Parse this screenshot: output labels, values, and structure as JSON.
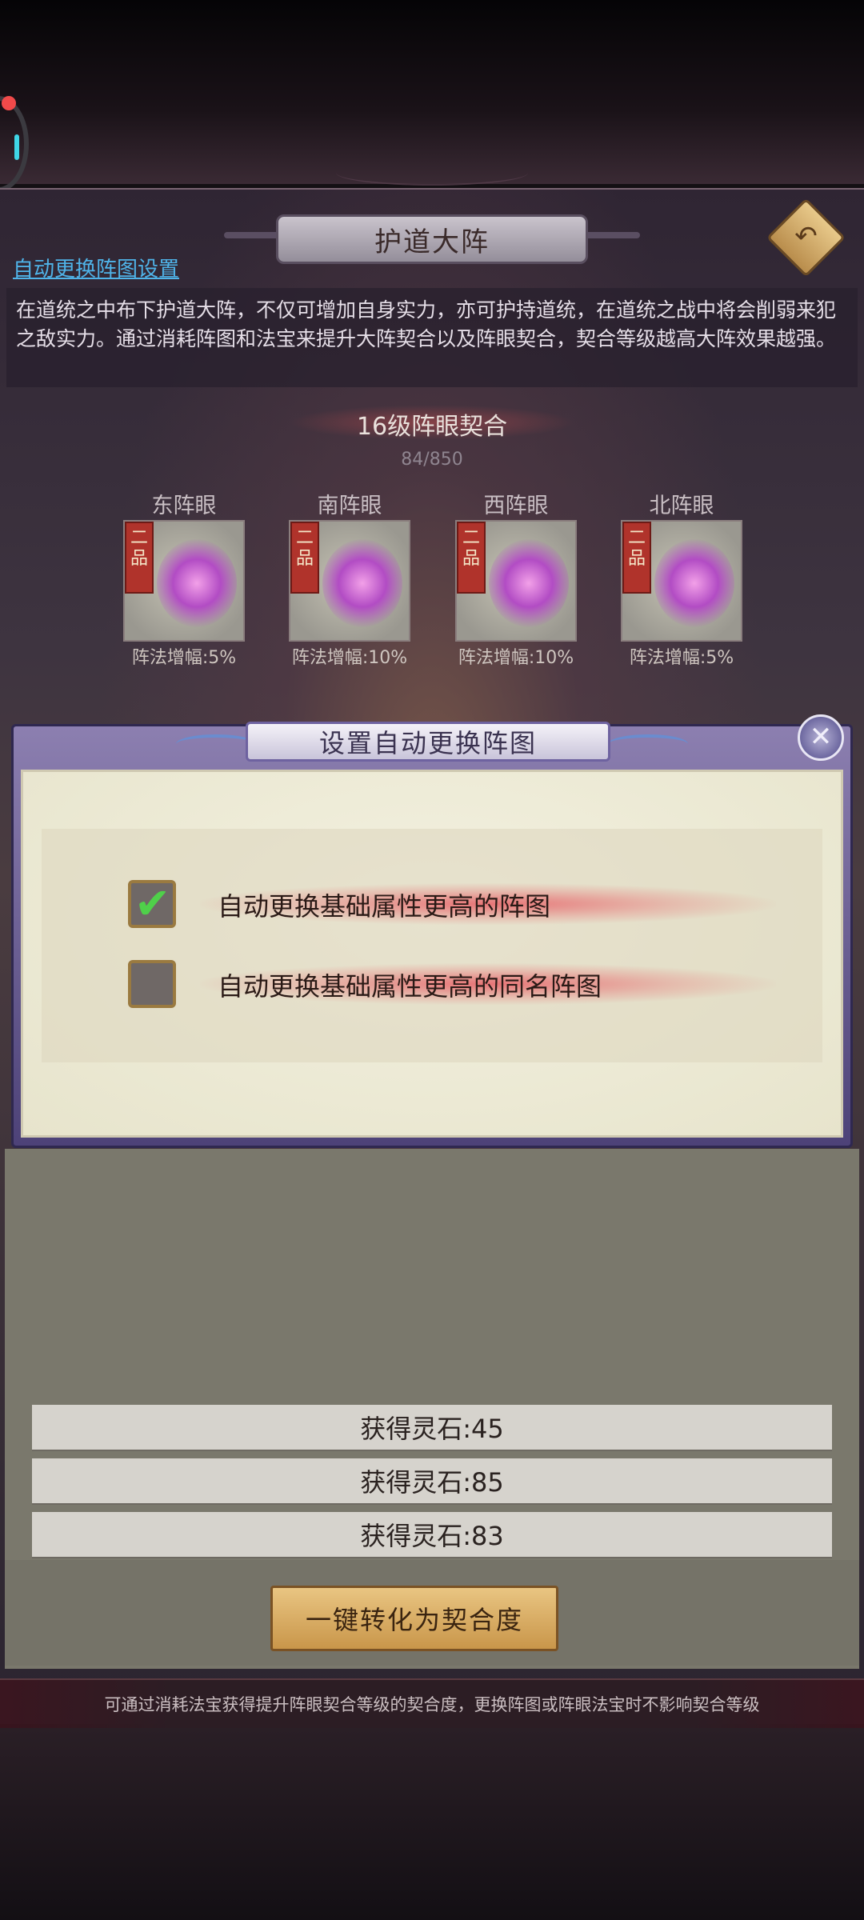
{
  "header": {
    "title": "护道大阵",
    "auto_settings_link": "自动更换阵图设置",
    "description": "在道统之中布下护道大阵，不仅可增加自身实力，亦可护持道统，在道统之战中将会削弱来犯之敌实力。通过消耗阵图和法宝来提升大阵契合以及阵眼契合，契合等级越高大阵效果越强。"
  },
  "level": {
    "title": "16级阵眼契合",
    "progress_text": "84/850",
    "progress": {
      "current": 84,
      "max": 850
    }
  },
  "array_eyes": [
    {
      "label": "东阵眼",
      "grade": "二品",
      "bonus": "阵法增幅:5%",
      "icon": "lotus-treasure-icon"
    },
    {
      "label": "南阵眼",
      "grade": "二品",
      "bonus": "阵法增幅:10%",
      "icon": "ruyi-treasure-icon"
    },
    {
      "label": "西阵眼",
      "grade": "二品",
      "bonus": "阵法增幅:10%",
      "icon": "boot-treasure-icon"
    },
    {
      "label": "北阵眼",
      "grade": "二品",
      "bonus": "阵法增幅:5%",
      "icon": "chest-treasure-icon"
    }
  ],
  "dialog": {
    "title": "设置自动更换阵图",
    "options": [
      {
        "label": "自动更换基础属性更高的阵图",
        "checked": true
      },
      {
        "label": "自动更换基础属性更高的同名阵图",
        "checked": false
      }
    ]
  },
  "rewards": [
    {
      "text": "获得灵石:45"
    },
    {
      "text": "获得灵石:85"
    },
    {
      "text": "获得灵石:83"
    }
  ],
  "convert_button": "一键转化为契合度",
  "footer_tip": "可通过消耗法宝获得提升阵眼契合等级的契合度，更换阵图或阵眼法宝时不影响契合等级",
  "colors": {
    "link": "#4fb3e8",
    "grade_badge": "#b0332b",
    "check": "#4fd04a",
    "button_gold": "#c9964a",
    "dialog_frame": "#6e62a0"
  }
}
